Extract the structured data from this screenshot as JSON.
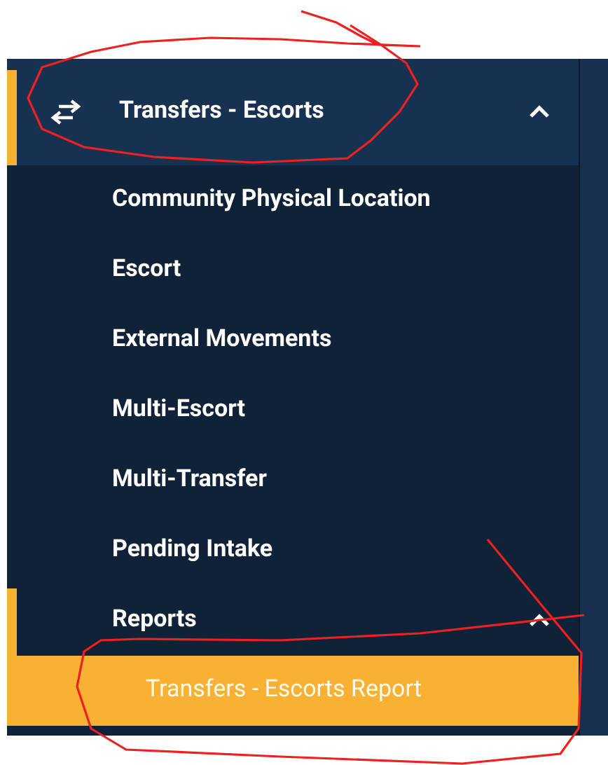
{
  "section": {
    "title": "Transfers - Escorts",
    "active": true,
    "expanded": true,
    "items": [
      {
        "kind": "link",
        "label": "Community Physical Location"
      },
      {
        "kind": "link",
        "label": "Escort"
      },
      {
        "kind": "link",
        "label": "External Movements"
      },
      {
        "kind": "link",
        "label": "Multi-Escort"
      },
      {
        "kind": "link",
        "label": "Multi-Transfer"
      },
      {
        "kind": "link",
        "label": "Pending Intake"
      },
      {
        "kind": "group",
        "label": "Reports",
        "active": true,
        "expanded": true,
        "children": [
          {
            "label": "Transfers - Escorts Report",
            "selected": true
          }
        ]
      }
    ]
  }
}
